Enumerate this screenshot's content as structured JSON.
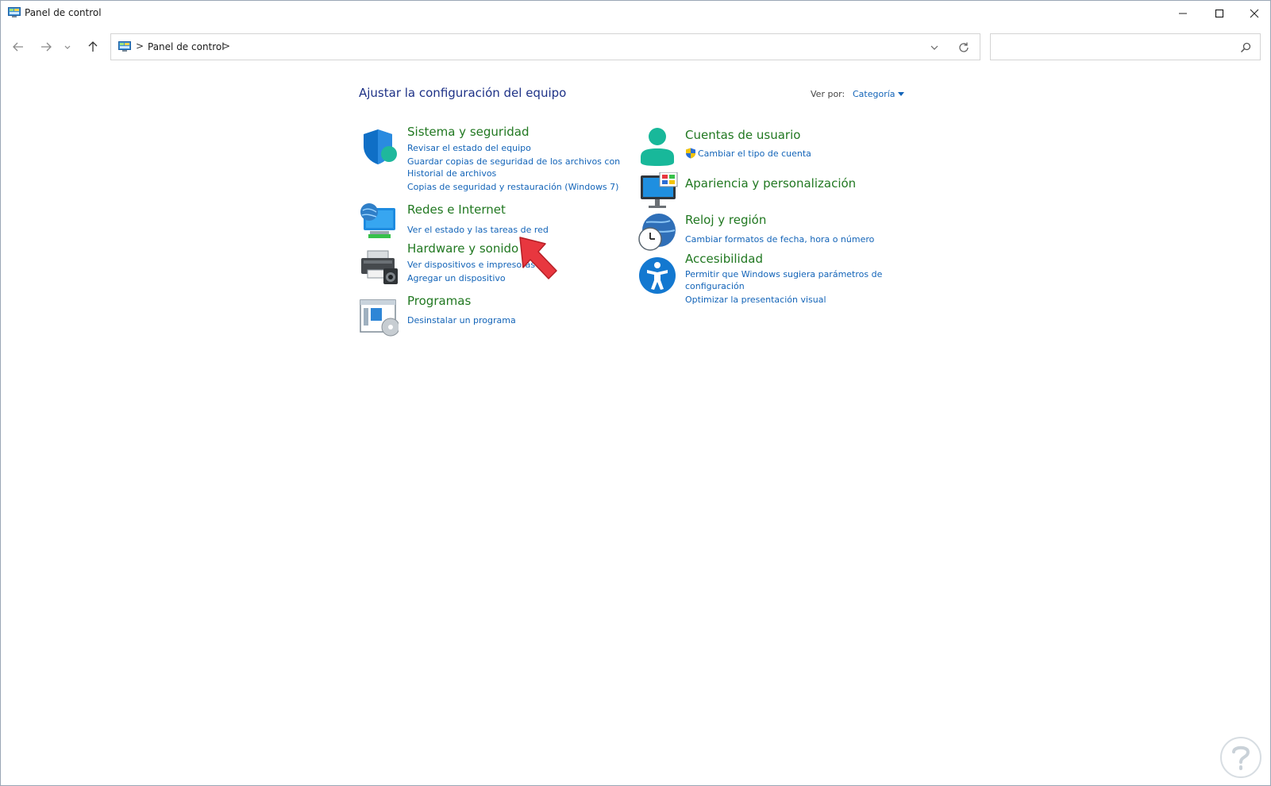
{
  "window": {
    "title": "Panel de control"
  },
  "address_bar": {
    "breadcrumb_item": "Panel de control",
    "separator": ">"
  },
  "search": {
    "placeholder": ""
  },
  "header": {
    "title": "Ajustar la configuración del equipo",
    "view_by_label": "Ver por:",
    "view_by_value": "Categoría"
  },
  "categories": {
    "system": {
      "title": "Sistema y seguridad",
      "links": [
        "Revisar el estado del equipo",
        "Guardar copias de seguridad de los archivos con",
        "Historial de archivos",
        "Copias de seguridad y restauración (Windows 7)"
      ]
    },
    "network": {
      "title": "Redes e Internet",
      "links": [
        "Ver el estado y las tareas de red"
      ]
    },
    "hardware": {
      "title": "Hardware y sonido",
      "links": [
        "Ver dispositivos e impresoras",
        "Agregar un dispositivo"
      ]
    },
    "programs": {
      "title": "Programas",
      "links": [
        "Desinstalar un programa"
      ]
    },
    "accounts": {
      "title": "Cuentas de usuario",
      "links": [
        "Cambiar el tipo de cuenta"
      ]
    },
    "appearance": {
      "title": "Apariencia y personalización"
    },
    "clock": {
      "title": "Reloj y región",
      "links": [
        "Cambiar formatos de fecha, hora o número"
      ]
    },
    "accessibility": {
      "title": "Accesibilidad",
      "links": [
        "Permitir que Windows sugiera parámetros de",
        "configuración",
        "Optimizar la presentación visual"
      ]
    }
  },
  "colors": {
    "category_title": "#217821",
    "link": "#1364b8",
    "heading": "#1e3287",
    "annotation_arrow": "#e8373f"
  }
}
